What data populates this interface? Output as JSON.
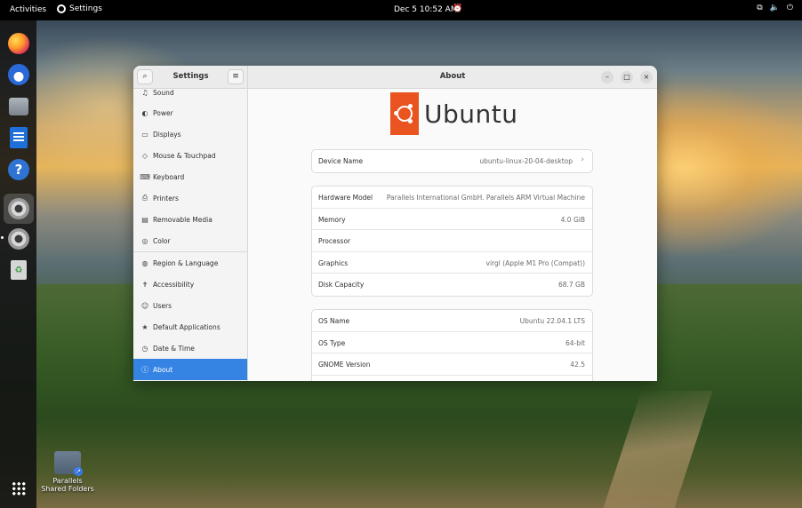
{
  "topbar": {
    "activities": "Activities",
    "app_name": "Settings",
    "clock": "Dec 5  10:52 AM",
    "icons": [
      "alarm-icon",
      "network-icon",
      "volume-icon",
      "power-icon"
    ]
  },
  "dock": {
    "items": [
      "firefox",
      "thunderbird",
      "files",
      "libreoffice-writer",
      "help",
      "settings",
      "settings",
      "trash",
      "show-apps"
    ]
  },
  "desktop": {
    "folder_label": "Parallels Shared Folders"
  },
  "window": {
    "sidebar_title": "Settings",
    "main_title": "About",
    "buttons": {
      "minimize": "–",
      "maximize": "□",
      "close": "×"
    }
  },
  "sidebar": {
    "items": [
      {
        "label": "Sound",
        "icon": "♫"
      },
      {
        "label": "Power",
        "icon": "◐"
      },
      {
        "label": "Displays",
        "icon": "▭"
      },
      {
        "label": "Mouse & Touchpad",
        "icon": "◇"
      },
      {
        "label": "Keyboard",
        "icon": "⌨"
      },
      {
        "label": "Printers",
        "icon": "⎙"
      },
      {
        "label": "Removable Media",
        "icon": "▤"
      },
      {
        "label": "Color",
        "icon": "◎"
      },
      {
        "label": "Region & Language",
        "icon": "◍"
      },
      {
        "label": "Accessibility",
        "icon": "✝"
      },
      {
        "label": "Users",
        "icon": "☺"
      },
      {
        "label": "Default Applications",
        "icon": "★"
      },
      {
        "label": "Date & Time",
        "icon": "◷"
      },
      {
        "label": "About",
        "icon": "ⓘ"
      }
    ],
    "active": "About"
  },
  "about": {
    "logo_text": "Ubuntu",
    "logo_color": "#E95420",
    "device": {
      "label": "Device Name",
      "value": "ubuntu-linux-20-04-desktop"
    },
    "hardware": [
      {
        "label": "Hardware Model",
        "value": "Parallels International GmbH. Parallels ARM Virtual Machine"
      },
      {
        "label": "Memory",
        "value": "4.0 GiB"
      },
      {
        "label": "Processor",
        "value": ""
      },
      {
        "label": "Graphics",
        "value": "virgl (Apple M1 Pro (Compat))"
      },
      {
        "label": "Disk Capacity",
        "value": "68.7 GB"
      }
    ],
    "os": [
      {
        "label": "OS Name",
        "value": "Ubuntu 22.04.1 LTS"
      },
      {
        "label": "OS Type",
        "value": "64-bit"
      },
      {
        "label": "GNOME Version",
        "value": "42.5"
      }
    ]
  },
  "colors": {
    "accent": "#3584E4",
    "topbar": "#000000",
    "window_bg": "#FAFAFA"
  }
}
